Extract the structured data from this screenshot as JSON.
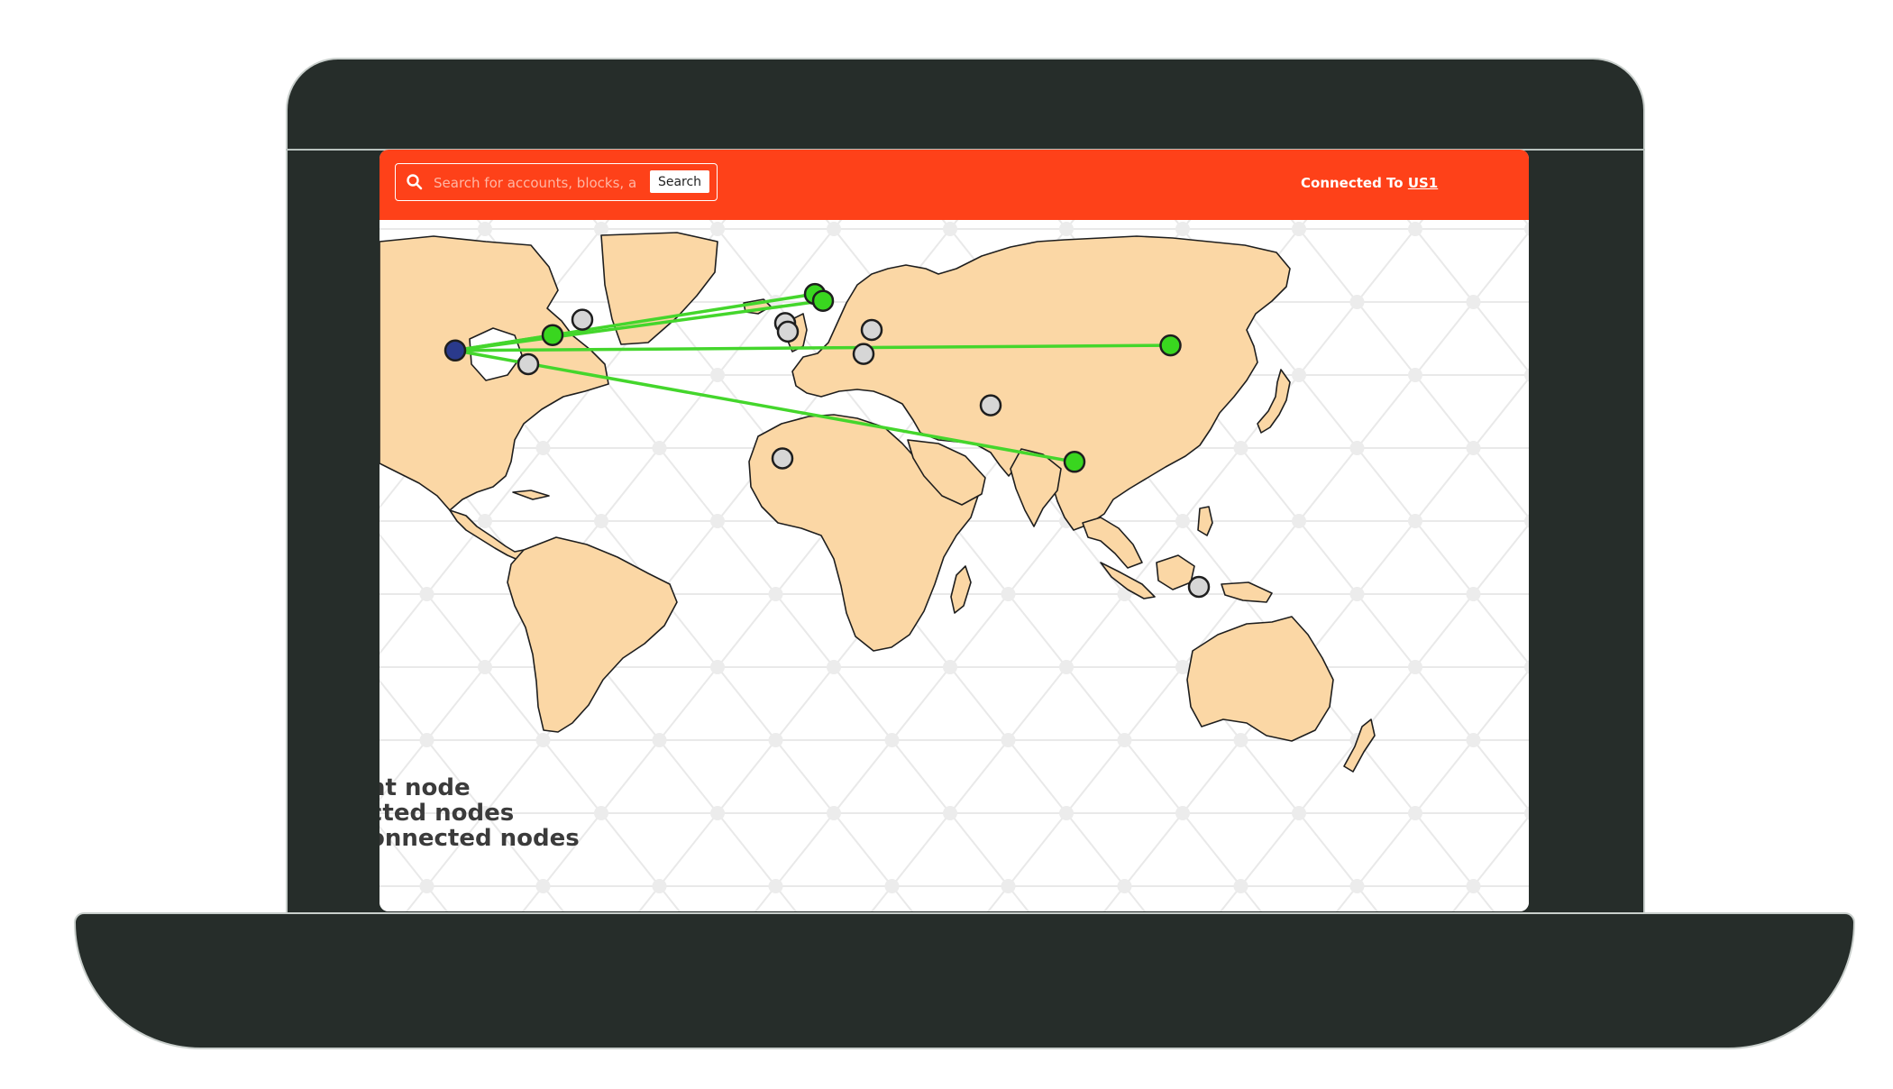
{
  "header": {
    "search_placeholder": "Search for accounts, blocks, a",
    "search_button": "Search",
    "connected_label": "Connected To",
    "connected_server": "US1"
  },
  "legend": [
    {
      "label": "nt node",
      "kind": "current"
    },
    {
      "label": "cted nodes",
      "kind": "connected"
    },
    {
      "label": "onnected nodes",
      "kind": "disconnected"
    }
  ],
  "colors": {
    "topbar": "#fe4119",
    "land": "#fbd7a5",
    "connected_node": "#39d61f",
    "disconnected_node": "#d6d6d6",
    "current_node": "#2a3a8c",
    "link": "#44d62c",
    "laptop": "#262d2a"
  },
  "current_node": {
    "name": "current-node",
    "lat": 34,
    "lon": -125
  },
  "nodes": [
    {
      "name": "node-us-central",
      "lat": 38.5,
      "lon": -89,
      "status": "connected"
    },
    {
      "name": "node-germany-west",
      "lat": 50.5,
      "lon": 8,
      "status": "connected"
    },
    {
      "name": "node-germany-south",
      "lat": 48.5,
      "lon": 11,
      "status": "connected"
    },
    {
      "name": "node-japan",
      "lat": 35.5,
      "lon": 139.5,
      "status": "connected"
    },
    {
      "name": "node-singapore",
      "lat": 1.5,
      "lon": 104,
      "status": "connected"
    },
    {
      "name": "node-us-northeast",
      "lat": 43,
      "lon": -78,
      "status": "disconnected"
    },
    {
      "name": "node-us-south",
      "lat": 30,
      "lon": -98,
      "status": "disconnected"
    },
    {
      "name": "node-spain",
      "lat": 42,
      "lon": -3,
      "status": "disconnected"
    },
    {
      "name": "node-spain-south",
      "lat": 39.5,
      "lon": -2,
      "status": "disconnected"
    },
    {
      "name": "node-turkey",
      "lat": 40,
      "lon": 29,
      "status": "disconnected"
    },
    {
      "name": "node-israel",
      "lat": 33,
      "lon": 26,
      "status": "disconnected"
    },
    {
      "name": "node-india",
      "lat": 18,
      "lon": 73,
      "status": "disconnected"
    },
    {
      "name": "node-gulf-of-guinea",
      "lat": 2.5,
      "lon": -4,
      "status": "disconnected"
    },
    {
      "name": "node-australia",
      "lat": -35,
      "lon": 150,
      "status": "disconnected"
    }
  ]
}
